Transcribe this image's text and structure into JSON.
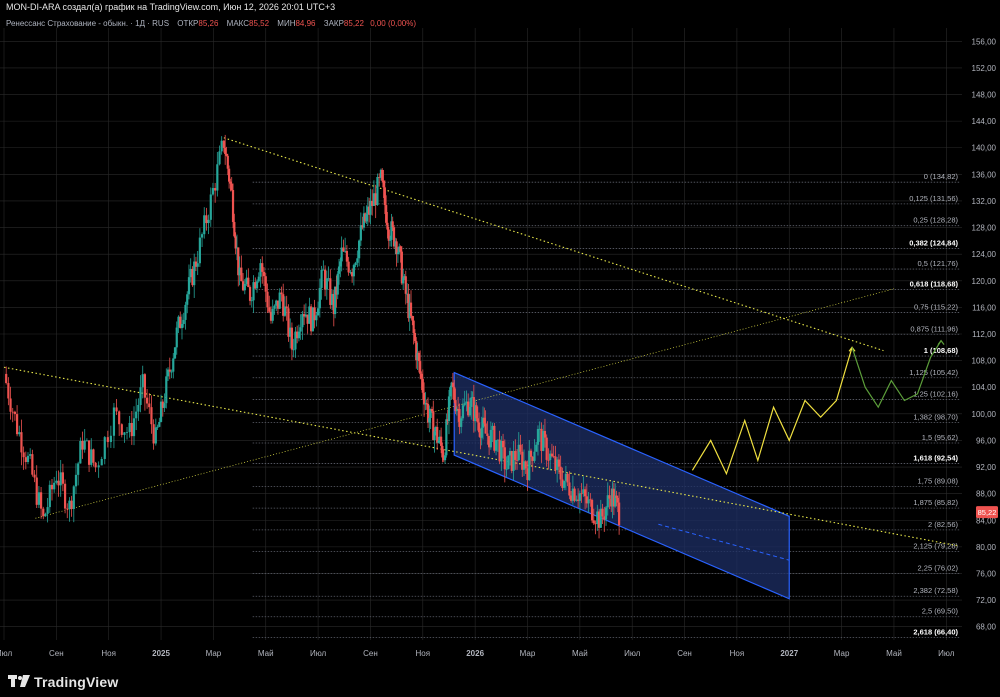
{
  "header": {
    "author_line": "MON-DI-ARA создал(а) график на TradingView.com, Июн 12, 2026 20:01 UTC+3"
  },
  "legend": {
    "instrument": "Ренессанс Страхование - обыкн. · 1Д · RUS",
    "open_label": "ОТКР",
    "open_value": "85,26",
    "high_label": "МАКС",
    "high_value": "85,52",
    "low_label": "МИН",
    "low_value": "84,96",
    "close_label": "ЗАКР",
    "close_value": "85,22",
    "change": "0,00 (0,00%)"
  },
  "footer": {
    "brand": "TradingView"
  },
  "colors": {
    "background": "#000000",
    "grid": "#2a2a2a",
    "up_candle": "#26a69a",
    "down_candle": "#ef5350",
    "channel": "#2962ff",
    "channel_fill": "#1e2f66",
    "trendline": "#e8e84a",
    "forecast_yellow": "#f0e040",
    "forecast_green": "#5c9e3a",
    "price_tag": "#ef5350"
  },
  "chart_data": {
    "type": "candlestick",
    "symbol": "Ренессанс Страхование - обыкн.",
    "timeframe": "1Д",
    "current_price": "85,22",
    "y_axis": {
      "range": [
        66,
        158
      ],
      "ticks": [
        "68,00",
        "72,00",
        "76,00",
        "80,00",
        "84,00",
        "88,00",
        "92,00",
        "96,00",
        "100,00",
        "104,00",
        "108,00",
        "112,00",
        "116,00",
        "120,00",
        "124,00",
        "128,00",
        "132,00",
        "136,00",
        "140,00",
        "144,00",
        "148,00",
        "152,00",
        "156,00"
      ]
    },
    "x_axis": {
      "ticks": [
        "Июл",
        "Сен",
        "Ноя",
        "2025",
        "Мар",
        "Май",
        "Июл",
        "Сен",
        "Ноя",
        "2026",
        "Мар",
        "Май",
        "Июл",
        "Сен",
        "Ноя",
        "2027",
        "Мар",
        "Май",
        "Июл"
      ],
      "tick_index": [
        0,
        2,
        4,
        6,
        8,
        10,
        12,
        14,
        16,
        18,
        20,
        22,
        24,
        26,
        28,
        30,
        32,
        34,
        36
      ],
      "range": [
        0,
        36.6
      ]
    },
    "price_path": [
      [
        0.0,
        106
      ],
      [
        0.5,
        98
      ],
      [
        1.0,
        92
      ],
      [
        1.5,
        84
      ],
      [
        2.0,
        91
      ],
      [
        2.5,
        86
      ],
      [
        3.0,
        96
      ],
      [
        3.5,
        92
      ],
      [
        4.2,
        100
      ],
      [
        4.8,
        97
      ],
      [
        5.3,
        104
      ],
      [
        5.8,
        96
      ],
      [
        6.2,
        104
      ],
      [
        6.6,
        112
      ],
      [
        7.0,
        118
      ],
      [
        7.4,
        124
      ],
      [
        7.9,
        132
      ],
      [
        8.4,
        141
      ],
      [
        8.7,
        133
      ],
      [
        9.0,
        120
      ],
      [
        9.4,
        118
      ],
      [
        9.8,
        123
      ],
      [
        10.2,
        114
      ],
      [
        10.6,
        118
      ],
      [
        11.0,
        110
      ],
      [
        11.4,
        116
      ],
      [
        11.8,
        114
      ],
      [
        12.2,
        121
      ],
      [
        12.6,
        116
      ],
      [
        12.9,
        124
      ],
      [
        13.3,
        122
      ],
      [
        13.7,
        128
      ],
      [
        14.0,
        131
      ],
      [
        14.4,
        135
      ],
      [
        14.7,
        128
      ],
      [
        15.0,
        126
      ],
      [
        15.3,
        119
      ],
      [
        15.6,
        113
      ],
      [
        15.9,
        106
      ],
      [
        16.2,
        100
      ],
      [
        16.5,
        97
      ],
      [
        16.8,
        94
      ],
      [
        17.1,
        104
      ],
      [
        17.4,
        100
      ],
      [
        17.8,
        102
      ],
      [
        18.1,
        99
      ],
      [
        18.4,
        97
      ],
      [
        18.8,
        96
      ],
      [
        19.2,
        92
      ],
      [
        19.6,
        94
      ],
      [
        20.0,
        92
      ],
      [
        20.4,
        97
      ],
      [
        20.8,
        94
      ],
      [
        21.2,
        91
      ],
      [
        21.6,
        89
      ],
      [
        22.0,
        88
      ],
      [
        22.4,
        86
      ],
      [
        22.8,
        84
      ],
      [
        23.2,
        88
      ],
      [
        23.5,
        85.22
      ]
    ],
    "fibonacci_levels": [
      {
        "label": "0 (134,82)",
        "value": 134.82,
        "bold": false
      },
      {
        "label": "0,125 (131,56)",
        "value": 131.56,
        "bold": false
      },
      {
        "label": "0,25 (128,28)",
        "value": 128.28,
        "bold": false
      },
      {
        "label": "0,382 (124,84)",
        "value": 124.84,
        "bold": true
      },
      {
        "label": "0,5 (121,76)",
        "value": 121.76,
        "bold": false
      },
      {
        "label": "0,618 (118,68)",
        "value": 118.68,
        "bold": true
      },
      {
        "label": "0,75 (115,22)",
        "value": 115.22,
        "bold": false
      },
      {
        "label": "0,875 (111,96)",
        "value": 111.96,
        "bold": false
      },
      {
        "label": "1 (108,68)",
        "value": 108.68,
        "bold": true
      },
      {
        "label": "1,125 (105,42)",
        "value": 105.42,
        "bold": false
      },
      {
        "label": "1,25 (102,16)",
        "value": 102.16,
        "bold": false
      },
      {
        "label": "1,382 (98,70)",
        "value": 98.7,
        "bold": false
      },
      {
        "label": "1,5 (95,62)",
        "value": 95.62,
        "bold": false
      },
      {
        "label": "1,618 (92,54)",
        "value": 92.54,
        "bold": true
      },
      {
        "label": "1,75 (89,08)",
        "value": 89.08,
        "bold": false
      },
      {
        "label": "1,875 (85,82)",
        "value": 85.82,
        "bold": false
      },
      {
        "label": "2 (82,56)",
        "value": 82.56,
        "bold": false
      },
      {
        "label": "2,125 (79,28)",
        "value": 79.28,
        "bold": false
      },
      {
        "label": "2,25 (76,02)",
        "value": 76.02,
        "bold": false
      },
      {
        "label": "2,382 (72,58)",
        "value": 72.58,
        "bold": false
      },
      {
        "label": "2,5 (69,50)",
        "value": 69.5,
        "bold": false
      },
      {
        "label": "2,618 (66,40)",
        "value": 66.4,
        "bold": true
      }
    ],
    "fib_start_x": 9.5,
    "trendlines": [
      {
        "name": "upper-resistance",
        "from": [
          8.4,
          141.5
        ],
        "to": [
          33.6,
          109.5
        ]
      },
      {
        "name": "lower-support",
        "from": [
          0.0,
          107
        ],
        "to": [
          36.4,
          80.2
        ]
      },
      {
        "name": "rising-support",
        "from": [
          1.2,
          84.3
        ],
        "to": [
          34.0,
          118.8
        ]
      }
    ],
    "channel": {
      "upper": [
        [
          17.2,
          106.2
        ],
        [
          30.0,
          84.6
        ]
      ],
      "lower": [
        [
          17.2,
          93.8
        ],
        [
          30.0,
          72.2
        ]
      ],
      "midline_dashed": [
        [
          25.0,
          83.4
        ],
        [
          30.0,
          78.0
        ]
      ]
    },
    "forecast_yellow": [
      [
        26.3,
        91.5
      ],
      [
        27.0,
        96
      ],
      [
        27.6,
        91
      ],
      [
        28.3,
        99
      ],
      [
        28.8,
        93
      ],
      [
        29.4,
        101
      ],
      [
        30.0,
        96
      ],
      [
        30.6,
        102
      ],
      [
        31.2,
        99.5
      ],
      [
        31.8,
        102
      ],
      [
        32.4,
        110
      ]
    ],
    "forecast_green": [
      [
        32.4,
        110
      ],
      [
        32.9,
        104
      ],
      [
        33.4,
        101
      ],
      [
        33.9,
        105
      ],
      [
        34.4,
        102
      ],
      [
        34.9,
        103
      ],
      [
        35.4,
        108.5
      ],
      [
        35.8,
        111
      ]
    ]
  }
}
